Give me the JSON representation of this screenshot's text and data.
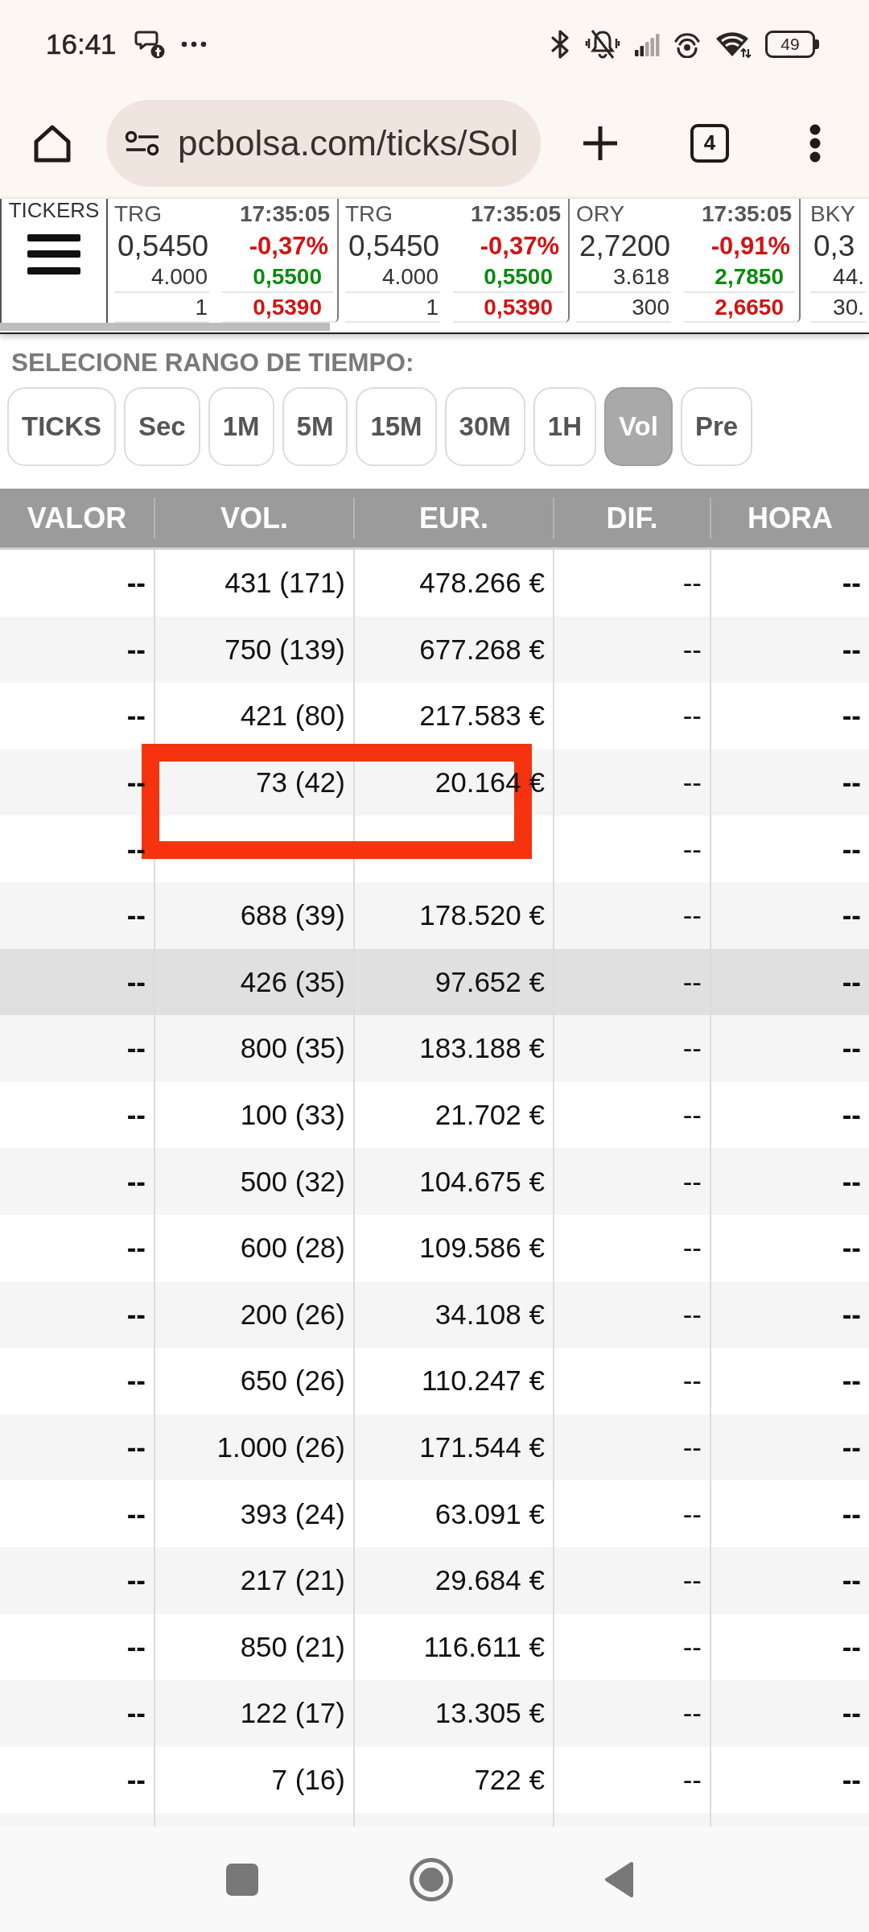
{
  "status_bar": {
    "time": "16:41",
    "battery": "49"
  },
  "browser": {
    "url": "pcbolsa.com/ticks/Sol",
    "tab_count": "4"
  },
  "tickers": {
    "label": "TICKERS",
    "cards": [
      {
        "symbol": "TRG",
        "time": "17:35:05",
        "price": "0,5450",
        "change": "-0,37%",
        "quantity_1": "4.000",
        "price_1": "0,5500",
        "quantity_2": "1",
        "price_2": "0,5390"
      },
      {
        "symbol": "TRG",
        "time": "17:35:05",
        "price": "0,5450",
        "change": "-0,37%",
        "quantity_1": "4.000",
        "price_1": "0,5500",
        "quantity_2": "1",
        "price_2": "0,5390"
      },
      {
        "symbol": "ORY",
        "time": "17:35:05",
        "price": "2,7200",
        "change": "-0,91%",
        "quantity_1": "3.618",
        "price_1": "2,7850",
        "quantity_2": "300",
        "price_2": "2,6650"
      },
      {
        "symbol": "BKY",
        "price": "0,3",
        "quantity_1": "44.",
        "quantity_2": "30."
      }
    ]
  },
  "time_range": {
    "label": "SELECIONE RANGO DE TIEMPO:",
    "options": [
      {
        "label": "TICKS",
        "selected": false
      },
      {
        "label": "Sec",
        "selected": false
      },
      {
        "label": "1M",
        "selected": false
      },
      {
        "label": "5M",
        "selected": false
      },
      {
        "label": "15M",
        "selected": false
      },
      {
        "label": "30M",
        "selected": false
      },
      {
        "label": "1H",
        "selected": false
      },
      {
        "label": "Vol",
        "selected": true
      },
      {
        "label": "Pre",
        "selected": false
      }
    ]
  },
  "table": {
    "columns": [
      "VALOR",
      "VOL.",
      "EUR.",
      "DIF.",
      "HORA"
    ],
    "rows": [
      {
        "valor": "--",
        "vol": "431 (171)",
        "eur": "478.266 €",
        "dif": "--",
        "hora": "--",
        "selected": false
      },
      {
        "valor": "--",
        "vol": "750 (139)",
        "eur": "677.268 €",
        "dif": "--",
        "hora": "--",
        "selected": false
      },
      {
        "valor": "--",
        "vol": "421 (80)",
        "eur": "217.583 €",
        "dif": "--",
        "hora": "--",
        "selected": false
      },
      {
        "valor": "--",
        "vol": "73 (42)",
        "eur": "20.164 €",
        "dif": "--",
        "hora": "--",
        "selected": false
      },
      {
        "valor": "--",
        "dif": "--",
        "hora": "--",
        "selected": false
      },
      {
        "valor": "--",
        "vol": "688 (39)",
        "eur": "178.520 €",
        "dif": "--",
        "hora": "--",
        "selected": false
      },
      {
        "valor": "--",
        "vol": "426 (35)",
        "eur": "97.652 €",
        "dif": "--",
        "hora": "--",
        "selected": true
      },
      {
        "valor": "--",
        "vol": "800 (35)",
        "eur": "183.188 €",
        "dif": "--",
        "hora": "--",
        "selected": false
      },
      {
        "valor": "--",
        "vol": "100 (33)",
        "eur": "21.702 €",
        "dif": "--",
        "hora": "--",
        "selected": false
      },
      {
        "valor": "--",
        "vol": "500 (32)",
        "eur": "104.675 €",
        "dif": "--",
        "hora": "--",
        "selected": false
      },
      {
        "valor": "--",
        "vol": "600 (28)",
        "eur": "109.586 €",
        "dif": "--",
        "hora": "--",
        "selected": false
      },
      {
        "valor": "--",
        "vol": "200 (26)",
        "eur": "34.108 €",
        "dif": "--",
        "hora": "--",
        "selected": false
      },
      {
        "valor": "--",
        "vol": "650 (26)",
        "eur": "110.247 €",
        "dif": "--",
        "hora": "--",
        "selected": false
      },
      {
        "valor": "--",
        "vol": "1.000 (26)",
        "eur": "171.544 €",
        "dif": "--",
        "hora": "--",
        "selected": false
      },
      {
        "valor": "--",
        "vol": "393 (24)",
        "eur": "63.091 €",
        "dif": "--",
        "hora": "--",
        "selected": false
      },
      {
        "valor": "--",
        "vol": "217 (21)",
        "eur": "29.684 €",
        "dif": "--",
        "hora": "--",
        "selected": false
      },
      {
        "valor": "--",
        "vol": "850 (21)",
        "eur": "116.611 €",
        "dif": "--",
        "hora": "--",
        "selected": false
      },
      {
        "valor": "--",
        "vol": "122 (17)",
        "eur": "13.305 €",
        "dif": "--",
        "hora": "--",
        "selected": false
      },
      {
        "valor": "--",
        "vol": "7 (16)",
        "eur": "722 €",
        "dif": "--",
        "hora": "--",
        "selected": false
      }
    ],
    "annotation": {
      "kind": "rectangle"
    }
  }
}
